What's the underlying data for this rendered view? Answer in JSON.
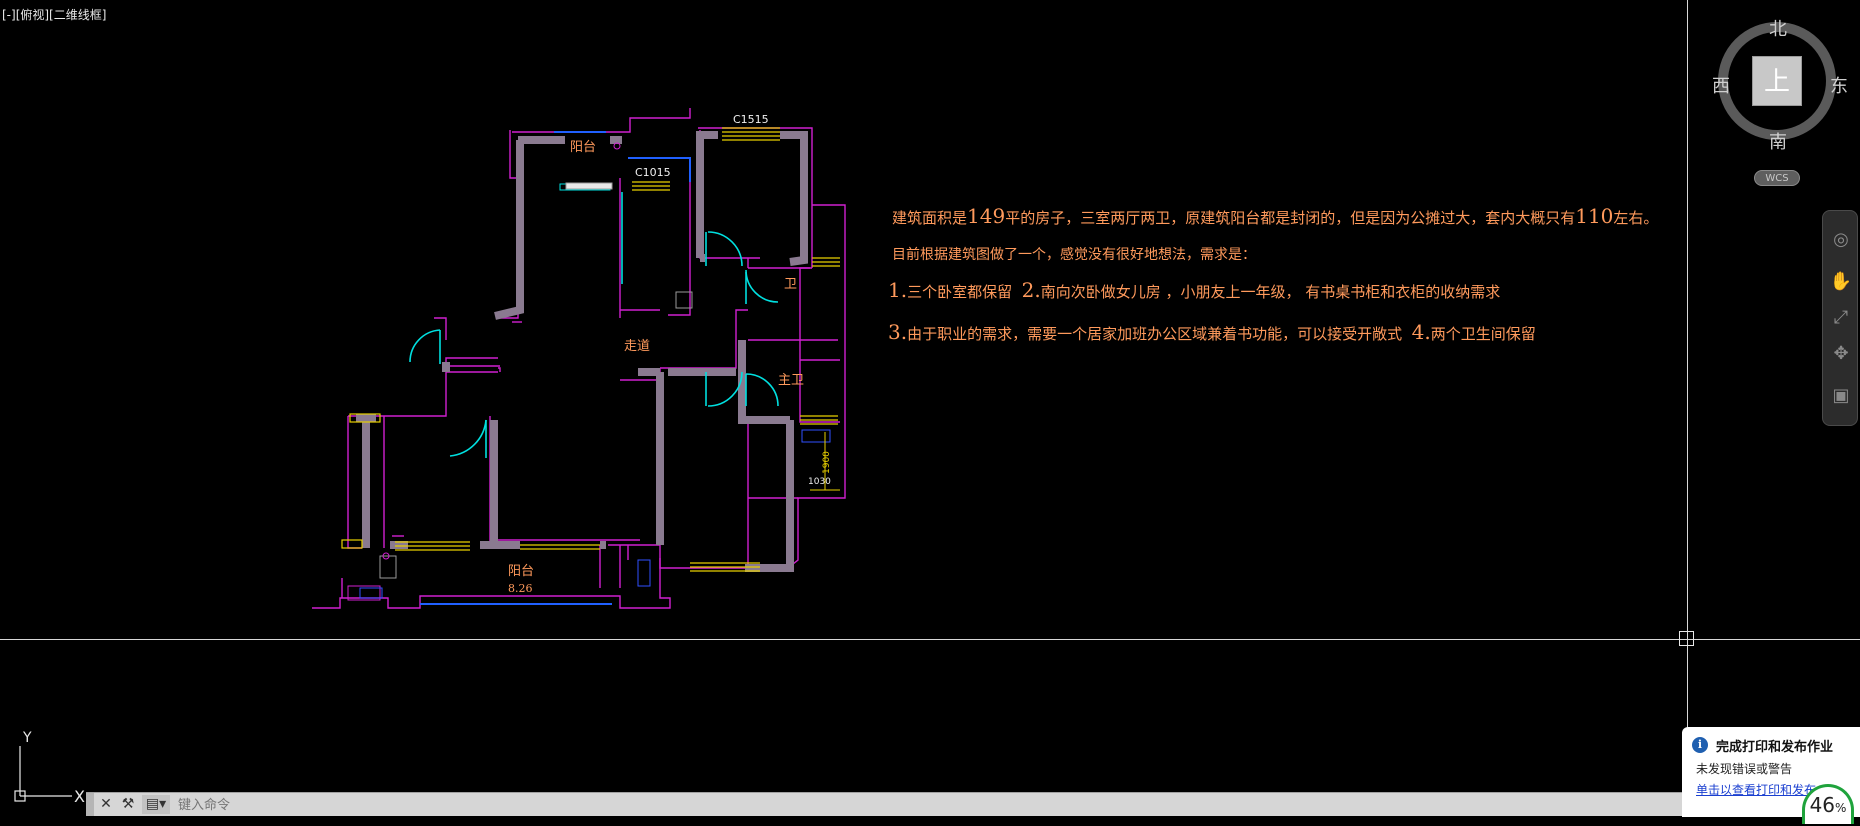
{
  "viewport": {
    "label": "[-][俯视][二维线框]"
  },
  "drawing": {
    "room_labels": {
      "balcony_top": "阳台",
      "corridor": "走道",
      "bath": "卫",
      "master_bath": "主卫",
      "balcony_bottom": "阳台",
      "balcony_bottom_area": "8.26"
    },
    "window_tags": {
      "c1515": "C1515",
      "c1015": "C1015"
    },
    "dimensions": {
      "d1900": "1900",
      "d1030": "1030"
    }
  },
  "notes": {
    "line1_a": "建筑面积是",
    "line1_num": "149",
    "line1_b": "平的房子，三室两厅两卫，原建筑阳台都是封闭的，但是因为公摊过大，套内大概只有",
    "line1_num2": "110",
    "line1_c": "左右。",
    "line2": "目前根据建筑图做了一个，感觉没有很好地想法，需求是：",
    "line3_n1": "1.",
    "line3_a": "三个卧室都保留",
    "line3_n2": "2.",
    "line3_b": "南向次卧做女儿房 ，小朋友上一年级，  有书桌书柜和衣柜的收纳需求",
    "line4_n3": "3.",
    "line4_a": "由于职业的需求，需要一个居家加班办公区域兼着书功能，可以接受开敞式",
    "line4_n4": "4.",
    "line4_b": "两个卫生间保留"
  },
  "viewcube": {
    "north": "北",
    "south": "南",
    "west": "西",
    "east": "东",
    "top_face": "上",
    "wcs": "WCS"
  },
  "ucs": {
    "x": "X",
    "y": "Y"
  },
  "command_line": {
    "placeholder": "键入命令"
  },
  "notification": {
    "title": "完成打印和发布作业",
    "message": "未发现错误或警告",
    "link": "单击以查看打印和发布",
    "progress": "46",
    "progress_unit": "%"
  },
  "icons": [
    "info-icon",
    "close-icon",
    "wrench-icon",
    "command-prompt-icon",
    "pan-icon",
    "zoom-icon",
    "orbit-icon",
    "steering-wheel-icon",
    "showmotion-icon"
  ]
}
